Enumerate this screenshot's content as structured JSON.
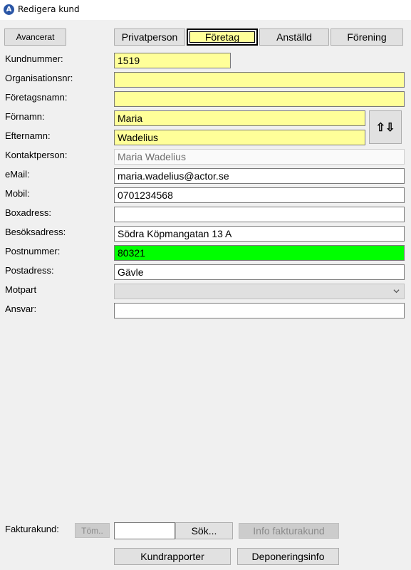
{
  "window": {
    "title": "Redigera kund"
  },
  "toolbar": {
    "advanced_label": "Avancerat"
  },
  "tabs": [
    {
      "label": "Privatperson"
    },
    {
      "label": "Företag"
    },
    {
      "label": "Anställd"
    },
    {
      "label": "Förening"
    }
  ],
  "form": {
    "customer_number": {
      "label": "Kundnummer:",
      "value": "1519"
    },
    "org_number": {
      "label": "Organisationsnr:",
      "value": ""
    },
    "company_name": {
      "label": "Företagsnamn:",
      "value": ""
    },
    "first_name": {
      "label": "Förnamn:",
      "value": "Maria"
    },
    "last_name": {
      "label": "Efternamn:",
      "value": "Wadelius"
    },
    "contact_person": {
      "label": "Kontaktperson:",
      "value": "Maria  Wadelius"
    },
    "email": {
      "label": "eMail:",
      "value": "maria.wadelius@actor.se"
    },
    "mobile": {
      "label": "Mobil:",
      "value": "0701234568"
    },
    "box_address": {
      "label": "Boxadress:",
      "value": ""
    },
    "visit_address": {
      "label": "Besöksadress:",
      "value": "Södra Köpmangatan 13 A"
    },
    "postal_code": {
      "label": "Postnummer:",
      "value": "80321"
    },
    "postal_address": {
      "label": "Postadress:",
      "value": "Gävle"
    },
    "counterpart": {
      "label": "Motpart",
      "value": ""
    },
    "responsible": {
      "label": "Ansvar:",
      "value": ""
    },
    "swap_label": "⇧⇩"
  },
  "invoice": {
    "label": "Fakturakund:",
    "clear_label": "Töm..",
    "input_value": "",
    "search_label": "Sök...",
    "info_label": "Info fakturakund"
  },
  "footer": {
    "reports_label": "Kundrapporter",
    "deposit_label": "Deponeringsinfo"
  },
  "colors": {
    "highlight_yellow": "#ffff99",
    "highlight_green": "#00ff00",
    "app_icon_blue": "#2a56a6"
  }
}
